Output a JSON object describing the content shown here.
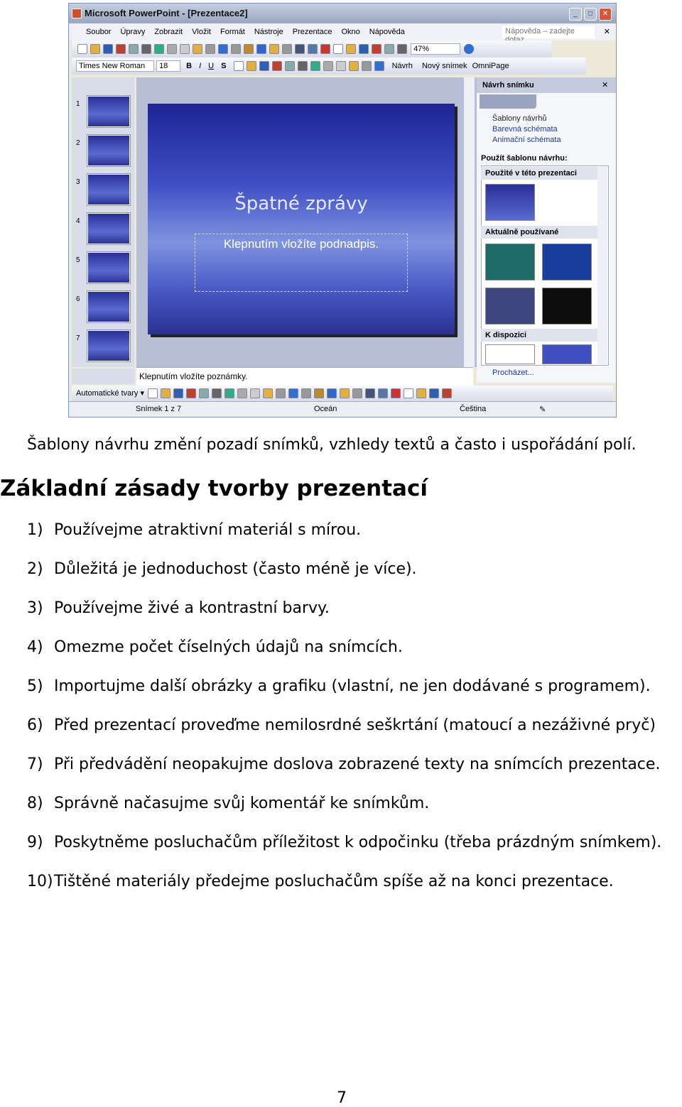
{
  "window": {
    "title": "Microsoft PowerPoint - [Prezentace2]",
    "menu": [
      "Soubor",
      "Úpravy",
      "Zobrazit",
      "Vložit",
      "Formát",
      "Nástroje",
      "Prezentace",
      "Okno",
      "Nápověda"
    ],
    "help_placeholder": "Nápověda – zadejte dotaz",
    "zoom": "47%",
    "font": "Times New Roman",
    "font_size": "18",
    "toolbar_buttons": {
      "design": "Návrh",
      "new_slide": "Nový snímek",
      "omnipage": "OmniPage"
    },
    "slide_numbers": [
      "1",
      "2",
      "3",
      "4",
      "5",
      "6",
      "7"
    ],
    "slide": {
      "title": "Špatné zprávy",
      "subtitle": "Klepnutím vložíte podnadpis."
    },
    "notes_placeholder": "Klepnutím vložíte poznámky.",
    "task_pane": {
      "title": "Návrh snímku",
      "links": [
        "Šablony návrhů",
        "Barevná schémata",
        "Animační schémata"
      ],
      "apply_label": "Použít šablonu návrhu:",
      "sections": [
        "Použité v této prezentaci",
        "Aktuálně používané",
        "K dispozici"
      ],
      "browse": "Procházet..."
    },
    "draw_toolbar": {
      "autoshapes": "Automatické tvary"
    },
    "status": {
      "slide": "Snímek 1 z 7",
      "design": "Oceán",
      "language": "Čeština"
    }
  },
  "doc": {
    "intro": "Šablony návrhu změní pozadí snímků, vzhledy textů a často i uspořádání polí.",
    "heading": "Základní zásady tvorby prezentací",
    "items": [
      {
        "n": "1)",
        "t": "Používejme atraktivní materiál s mírou."
      },
      {
        "n": "2)",
        "t": "Důležitá je jednoduchost (často méně je více)."
      },
      {
        "n": "3)",
        "t": "Používejme živé a kontrastní barvy."
      },
      {
        "n": "4)",
        "t": "Omezme počet číselných údajů na snímcích."
      },
      {
        "n": "5)",
        "t": "Importujme další obrázky a grafiku (vlastní, ne jen dodávané s  programem)."
      },
      {
        "n": "6)",
        "t": "Před prezentací proveďme nemilosrdné seškrtání (matoucí a nezáživné pryč)"
      },
      {
        "n": "7)",
        "t": "Při předvádění neopakujme doslova zobrazené texty na snímcích prezentace."
      },
      {
        "n": "8)",
        "t": "Správně načasujme svůj komentář ke snímkům."
      },
      {
        "n": "9)",
        "t": "Poskytněme posluchačům příležitost k odpočinku (třeba prázdným snímkem)."
      },
      {
        "n": "10)",
        "t": "Tištěné materiály předejme posluchačům spíše až na konci prezentace."
      }
    ],
    "page_number": "7"
  }
}
